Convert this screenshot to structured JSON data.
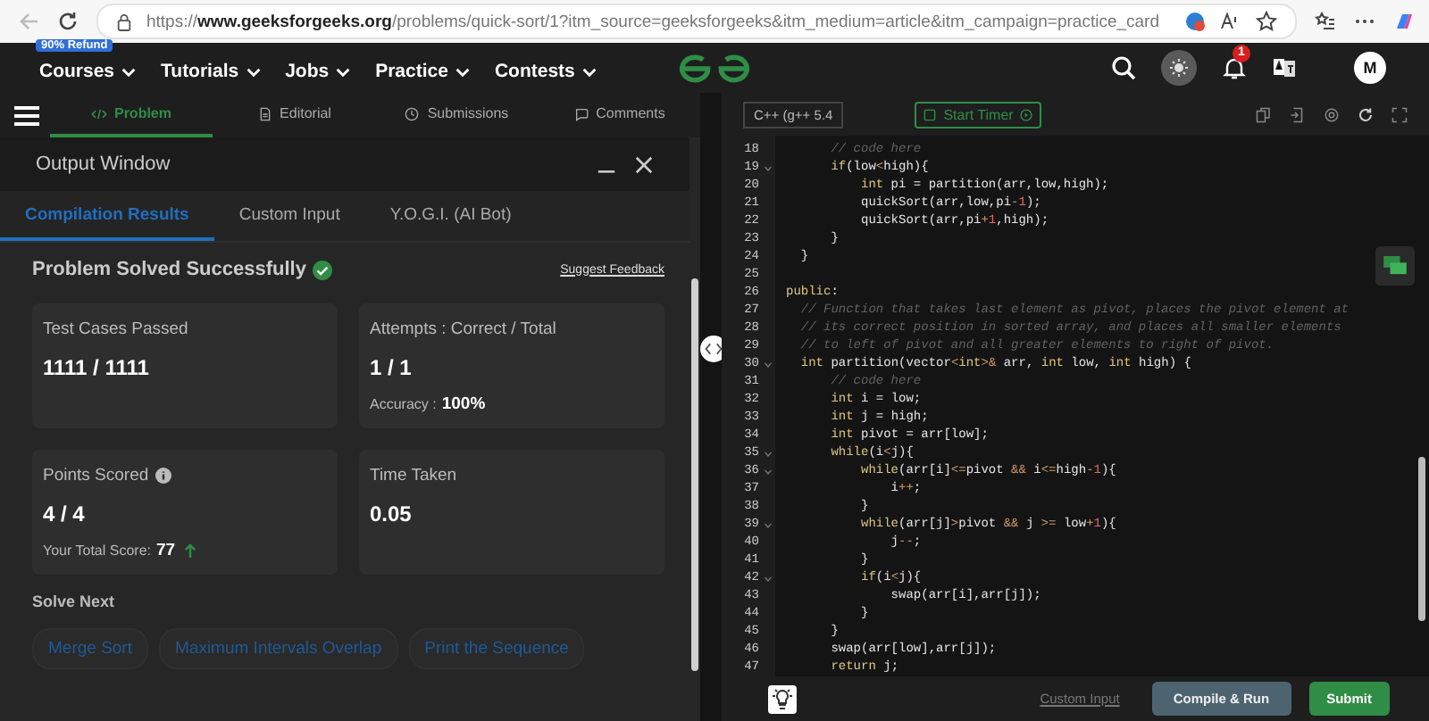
{
  "browser": {
    "url": "https://**www.geeksforgeeks.org**/problems/quick-sort/1?itm_source=geeksforgeeks&itm_medium=article&itm_campaign=practice_card"
  },
  "nav": {
    "badge": "90% Refund",
    "items": [
      "Courses",
      "Tutorials",
      "Jobs",
      "Practice",
      "Contests"
    ],
    "notification_count": "1",
    "avatar": "M"
  },
  "problem_tabs": [
    {
      "label": "Problem",
      "selected": true
    },
    {
      "label": "Editorial",
      "selected": false
    },
    {
      "label": "Submissions",
      "selected": false
    },
    {
      "label": "Comments",
      "selected": false
    }
  ],
  "output_window": {
    "title": "Output Window",
    "tabs": [
      {
        "label": "Compilation Results",
        "selected": true
      },
      {
        "label": "Custom Input",
        "selected": false
      },
      {
        "label": "Y.O.G.I. (AI Bot)",
        "selected": false
      }
    ],
    "status": "Problem Solved Successfully",
    "feedback_link": "Suggest Feedback",
    "cards": [
      {
        "label": "Test Cases Passed",
        "info": false,
        "value": "1111 / 1111"
      },
      {
        "label": "Attempts : Correct / Total",
        "info": false,
        "value": "1 / 1",
        "note": {
          "label": "Accuracy :",
          "value": "100%",
          "arrow": false
        }
      },
      {
        "label": "Points Scored",
        "info": true,
        "value": "4 / 4",
        "note": {
          "label": "Your Total Score:",
          "value": "77",
          "arrow": true
        }
      },
      {
        "label": "Time Taken",
        "info": false,
        "value": "0.05"
      }
    ],
    "solve_next": {
      "title": "Solve Next",
      "items": [
        "Merge Sort",
        "Maximum Intervals Overlap",
        "Print the Sequence"
      ]
    }
  },
  "editor": {
    "language": "C++ (g++ 5.4",
    "timer": "Start Timer",
    "lines": [
      {
        "number": "18",
        "fold": false,
        "tokens": [
          {
            "text": "      // code here",
            "kind": "comment"
          }
        ]
      },
      {
        "number": "19",
        "fold": true,
        "tokens": [
          {
            "text": "      if",
            "kind": "keyword"
          },
          {
            "text": "(low",
            "kind": "plain"
          },
          {
            "text": "<",
            "kind": "op"
          },
          {
            "text": "high){",
            "kind": "plain"
          }
        ]
      },
      {
        "number": "20",
        "fold": false,
        "tokens": [
          {
            "text": "          int",
            "kind": "keyword"
          },
          {
            "text": " pi = partition(arr,low,high);",
            "kind": "plain"
          }
        ]
      },
      {
        "number": "21",
        "fold": false,
        "tokens": [
          {
            "text": "          quickSort(arr,low,pi",
            "kind": "plain"
          },
          {
            "text": "-",
            "kind": "op"
          },
          {
            "text": "1",
            "kind": "number"
          },
          {
            "text": ");",
            "kind": "plain"
          }
        ]
      },
      {
        "number": "22",
        "fold": false,
        "tokens": [
          {
            "text": "          quickSort(arr,pi",
            "kind": "plain"
          },
          {
            "text": "+",
            "kind": "op"
          },
          {
            "text": "1",
            "kind": "number"
          },
          {
            "text": ",high);",
            "kind": "plain"
          }
        ]
      },
      {
        "number": "23",
        "fold": false,
        "tokens": [
          {
            "text": "      }",
            "kind": "plain"
          }
        ]
      },
      {
        "number": "24",
        "fold": false,
        "tokens": [
          {
            "text": "  }",
            "kind": "plain"
          }
        ]
      },
      {
        "number": "25",
        "fold": false
      },
      {
        "number": "26",
        "fold": false,
        "tokens": [
          {
            "text": "public",
            "kind": "keyword"
          },
          {
            "text": ":",
            "kind": "plain"
          }
        ]
      },
      {
        "number": "27",
        "fold": false,
        "tokens": [
          {
            "text": "  // Function that takes last element as pivot, places the pivot element at",
            "kind": "comment"
          }
        ]
      },
      {
        "number": "28",
        "fold": false,
        "tokens": [
          {
            "text": "  // its correct position in sorted array, and places all smaller elements",
            "kind": "comment"
          }
        ]
      },
      {
        "number": "29",
        "fold": false,
        "tokens": [
          {
            "text": "  // to left of pivot and all greater elements to right of pivot.",
            "kind": "comment"
          }
        ]
      },
      {
        "number": "30",
        "fold": true,
        "tokens": [
          {
            "text": "  int",
            "kind": "keyword"
          },
          {
            "text": " partition(vector",
            "kind": "plain"
          },
          {
            "text": "<",
            "kind": "op"
          },
          {
            "text": "int",
            "kind": "keyword"
          },
          {
            "text": ">&",
            "kind": "op"
          },
          {
            "text": " arr, ",
            "kind": "plain"
          },
          {
            "text": "int",
            "kind": "keyword"
          },
          {
            "text": " low, ",
            "kind": "plain"
          },
          {
            "text": "int",
            "kind": "keyword"
          },
          {
            "text": " high) {",
            "kind": "plain"
          }
        ]
      },
      {
        "number": "31",
        "fold": false,
        "tokens": [
          {
            "text": "      // code here",
            "kind": "comment"
          }
        ]
      },
      {
        "number": "32",
        "fold": false,
        "tokens": [
          {
            "text": "      int",
            "kind": "keyword"
          },
          {
            "text": " i = low;",
            "kind": "plain"
          }
        ]
      },
      {
        "number": "33",
        "fold": false,
        "tokens": [
          {
            "text": "      int",
            "kind": "keyword"
          },
          {
            "text": " j = high;",
            "kind": "plain"
          }
        ]
      },
      {
        "number": "34",
        "fold": false,
        "tokens": [
          {
            "text": "      int",
            "kind": "keyword"
          },
          {
            "text": " pivot = arr[low];",
            "kind": "plain"
          }
        ]
      },
      {
        "number": "35",
        "fold": true,
        "tokens": [
          {
            "text": "      while",
            "kind": "keyword"
          },
          {
            "text": "(i",
            "kind": "plain"
          },
          {
            "text": "<",
            "kind": "op"
          },
          {
            "text": "j){",
            "kind": "plain"
          }
        ]
      },
      {
        "number": "36",
        "fold": true,
        "tokens": [
          {
            "text": "          while",
            "kind": "keyword"
          },
          {
            "text": "(arr[i]",
            "kind": "plain"
          },
          {
            "text": "<=",
            "kind": "op"
          },
          {
            "text": "pivot ",
            "kind": "plain"
          },
          {
            "text": "&&",
            "kind": "op"
          },
          {
            "text": " i",
            "kind": "plain"
          },
          {
            "text": "<=",
            "kind": "op"
          },
          {
            "text": "high",
            "kind": "plain"
          },
          {
            "text": "-",
            "kind": "op"
          },
          {
            "text": "1",
            "kind": "number"
          },
          {
            "text": "){",
            "kind": "plain"
          }
        ]
      },
      {
        "number": "37",
        "fold": false,
        "tokens": [
          {
            "text": "              i",
            "kind": "plain"
          },
          {
            "text": "++",
            "kind": "op"
          },
          {
            "text": ";",
            "kind": "plain"
          }
        ]
      },
      {
        "number": "38",
        "fold": false,
        "tokens": [
          {
            "text": "          }",
            "kind": "plain"
          }
        ]
      },
      {
        "number": "39",
        "fold": true,
        "tokens": [
          {
            "text": "          while",
            "kind": "keyword"
          },
          {
            "text": "(arr[j]",
            "kind": "plain"
          },
          {
            "text": ">",
            "kind": "op"
          },
          {
            "text": "pivot ",
            "kind": "plain"
          },
          {
            "text": "&&",
            "kind": "op"
          },
          {
            "text": " j ",
            "kind": "plain"
          },
          {
            "text": ">=",
            "kind": "op"
          },
          {
            "text": " low",
            "kind": "plain"
          },
          {
            "text": "+",
            "kind": "op"
          },
          {
            "text": "1",
            "kind": "number"
          },
          {
            "text": "){",
            "kind": "plain"
          }
        ]
      },
      {
        "number": "40",
        "fold": false,
        "tokens": [
          {
            "text": "              j",
            "kind": "plain"
          },
          {
            "text": "--",
            "kind": "op"
          },
          {
            "text": ";",
            "kind": "plain"
          }
        ]
      },
      {
        "number": "41",
        "fold": false,
        "tokens": [
          {
            "text": "          }",
            "kind": "plain"
          }
        ]
      },
      {
        "number": "42",
        "fold": true,
        "tokens": [
          {
            "text": "          if",
            "kind": "keyword"
          },
          {
            "text": "(i",
            "kind": "plain"
          },
          {
            "text": "<",
            "kind": "op"
          },
          {
            "text": "j){",
            "kind": "plain"
          }
        ]
      },
      {
        "number": "43",
        "fold": false,
        "tokens": [
          {
            "text": "              swap(arr[i],arr[j]);",
            "kind": "plain"
          }
        ]
      },
      {
        "number": "44",
        "fold": false,
        "tokens": [
          {
            "text": "          }",
            "kind": "plain"
          }
        ]
      },
      {
        "number": "45",
        "fold": false,
        "tokens": [
          {
            "text": "      }",
            "kind": "plain"
          }
        ]
      },
      {
        "number": "46",
        "fold": false,
        "tokens": [
          {
            "text": "      swap(arr[low],arr[j]);",
            "kind": "plain"
          }
        ]
      },
      {
        "number": "47",
        "fold": false,
        "tokens": [
          {
            "text": "      return",
            "kind": "keyword"
          },
          {
            "text": " j;",
            "kind": "plain"
          }
        ]
      }
    ]
  },
  "footer": {
    "custom_input": "Custom Input",
    "compile": "Compile & Run",
    "submit": "Submit"
  }
}
